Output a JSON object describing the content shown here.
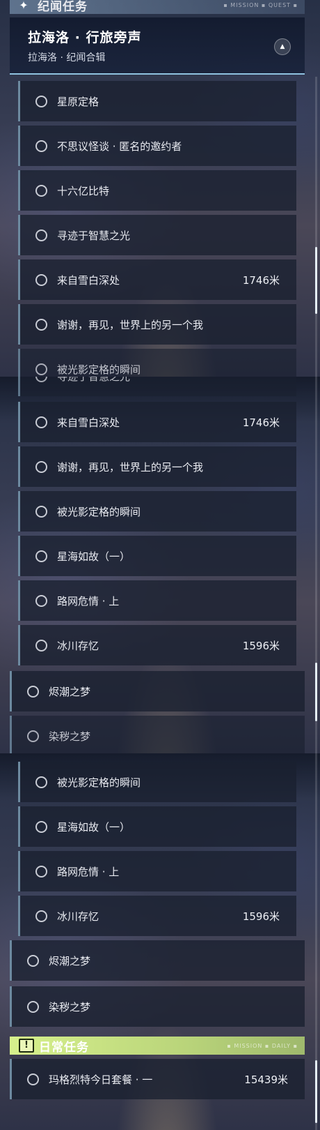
{
  "story_section": {
    "title": "纪闻任务",
    "deco": "▪ MISSION ▪ QUEST ▪"
  },
  "region": {
    "title": "拉海洛 · 行旅旁声",
    "subtitle": "拉海洛 · 纪闻合辑"
  },
  "daily_section": {
    "title": "日常任务",
    "deco": "▪ MISSION ▪ DAILY ▪"
  },
  "quests": [
    {
      "name": "星原定格",
      "distance": ""
    },
    {
      "name": "不思议怪谈 · 匿名的邀约者",
      "distance": ""
    },
    {
      "name": "十六亿比特",
      "distance": ""
    },
    {
      "name": "寻迹于智慧之光",
      "distance": ""
    },
    {
      "name": "来自雪白深处",
      "distance": "1746米"
    },
    {
      "name": "谢谢，再见，世界上的另一个我",
      "distance": ""
    },
    {
      "name": "被光影定格的瞬间",
      "distance": ""
    },
    {
      "name": "星海如故（一）",
      "distance": ""
    },
    {
      "name": "路网危情 · 上",
      "distance": ""
    },
    {
      "name": "冰川存忆",
      "distance": "1596米"
    }
  ],
  "top_quests": [
    {
      "name": "烬潮之梦",
      "distance": ""
    },
    {
      "name": "染秽之梦",
      "distance": ""
    }
  ],
  "daily_quests": [
    {
      "name": "玛格烈特今日套餐 · 一",
      "distance": "15439米"
    }
  ],
  "scroll": {
    "panel_a": 0.5,
    "panel_b": 0.8,
    "panel_c": 1.0
  }
}
